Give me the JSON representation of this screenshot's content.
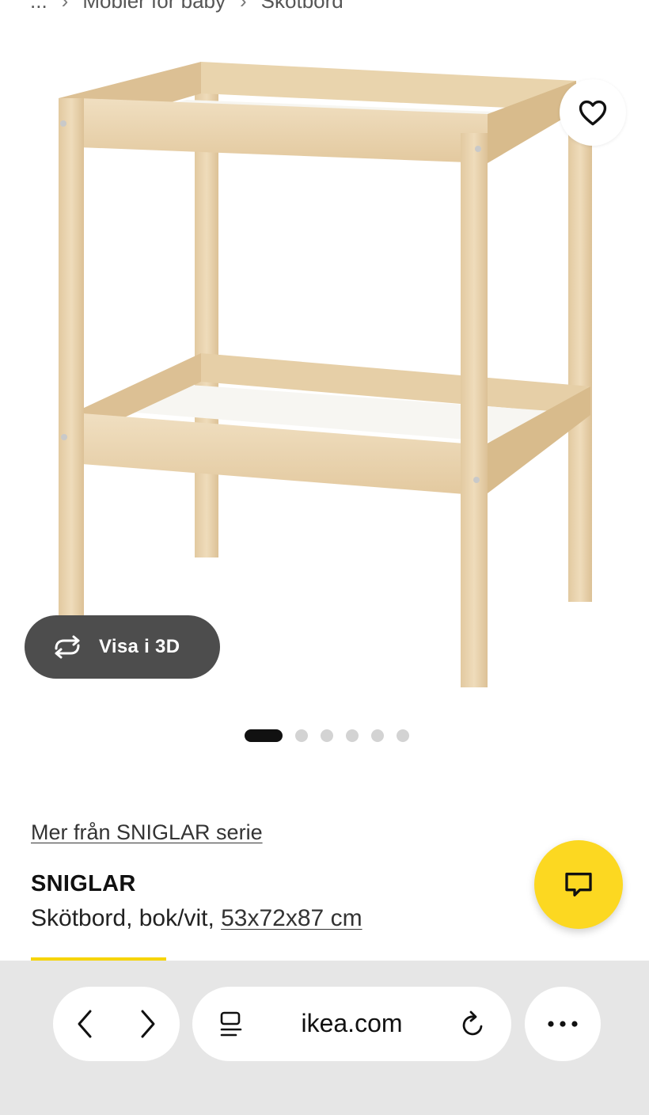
{
  "breadcrumb": {
    "items": [
      "...",
      "Möbler för baby",
      "Skötbord"
    ],
    "separator": "›"
  },
  "gallery": {
    "favorite_icon": "heart-icon",
    "view3d_icon": "rotate-3d-icon",
    "view3d_label": "Visa i 3D",
    "total_images": 6,
    "active_index": 0
  },
  "product": {
    "series_link": "Mer från SNIGLAR serie",
    "name": "SNIGLAR",
    "description": "Skötbord, bok/vit, ",
    "dimensions": "53x72x87 cm"
  },
  "chat": {
    "icon": "chat-bubble-icon",
    "color": "#fcd821"
  },
  "browser": {
    "url": "ikea.com",
    "back_icon": "chevron-left-icon",
    "forward_icon": "chevron-right-icon",
    "reader_icon": "reader-mode-icon",
    "reload_icon": "reload-icon",
    "more_icon": "more-icon"
  }
}
